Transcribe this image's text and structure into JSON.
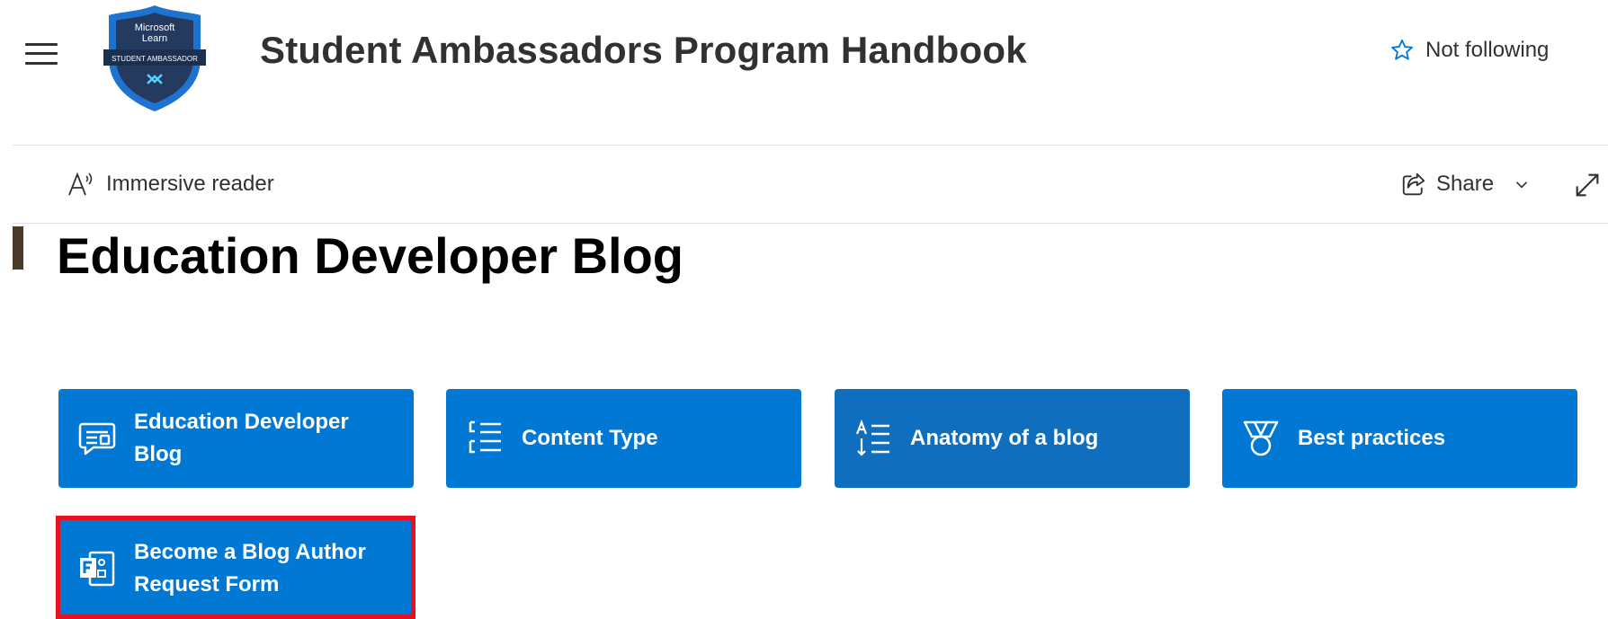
{
  "header": {
    "site_title": "Student Ambassadors Program Handbook",
    "follow_label": "Not following",
    "logo": {
      "line1": "Microsoft",
      "line2": "Learn",
      "banner": "STUDENT AMBASSADOR"
    }
  },
  "command_bar": {
    "immersive_reader_label": "Immersive reader",
    "share_label": "Share"
  },
  "page": {
    "title": "Education Developer Blog"
  },
  "tiles": [
    {
      "label": "Education Developer Blog",
      "icon": "blog-comment-icon"
    },
    {
      "label": "Content Type",
      "icon": "list-icon"
    },
    {
      "label": "Anatomy of a blog",
      "icon": "text-sort-icon"
    },
    {
      "label": "Best practices",
      "icon": "ribbon-badge-icon"
    },
    {
      "label": "Become a Blog Author Request Form",
      "icon": "forms-icon"
    }
  ],
  "colors": {
    "tile_blue": "#0078d4",
    "tile_hover_blue": "#106ebe",
    "highlight_red": "#e81123",
    "title_accent": "#4a3a2a",
    "follow_star": "#0078d4"
  }
}
